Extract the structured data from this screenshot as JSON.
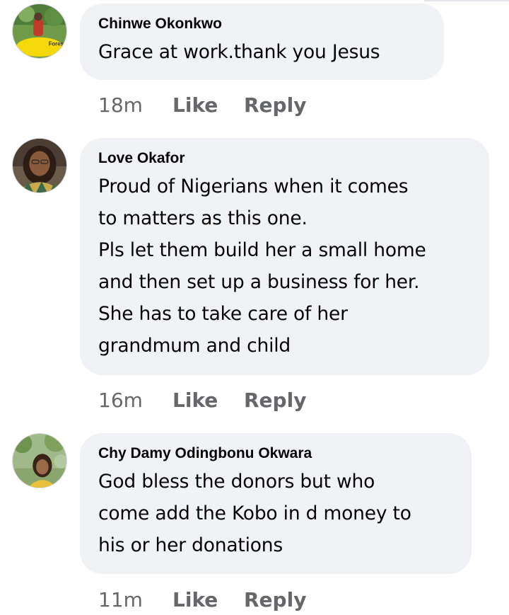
{
  "comments": [
    {
      "author": "Chinwe Okonkwo",
      "text": "Grace at work.thank you Jesus",
      "time": "18m",
      "like_label": "Like",
      "reply_label": "Reply",
      "avatar_badge": "Forester",
      "avatar_desc": "person-outdoors-avatar"
    },
    {
      "author": "Love Okafor",
      "text": "Proud of Nigerians when it comes\nto matters as this one.\nPls let them build her a small home\nand then set up a business for her.\nShe has to take care of her\ngrandmum and child",
      "time": "16m",
      "like_label": "Like",
      "reply_label": "Reply",
      "avatar_desc": "woman-portrait-avatar"
    },
    {
      "author": "Chy Damy Odingbonu Okwara",
      "text": "God bless the donors but who\ncome add the Kobo in d money to\nhis or her donations",
      "time": "11m",
      "like_label": "Like",
      "reply_label": "Reply",
      "avatar_desc": "woman-garden-avatar"
    }
  ],
  "colors": {
    "bubble": "#f0f2f5",
    "text": "#050505",
    "meta": "#65676b"
  }
}
